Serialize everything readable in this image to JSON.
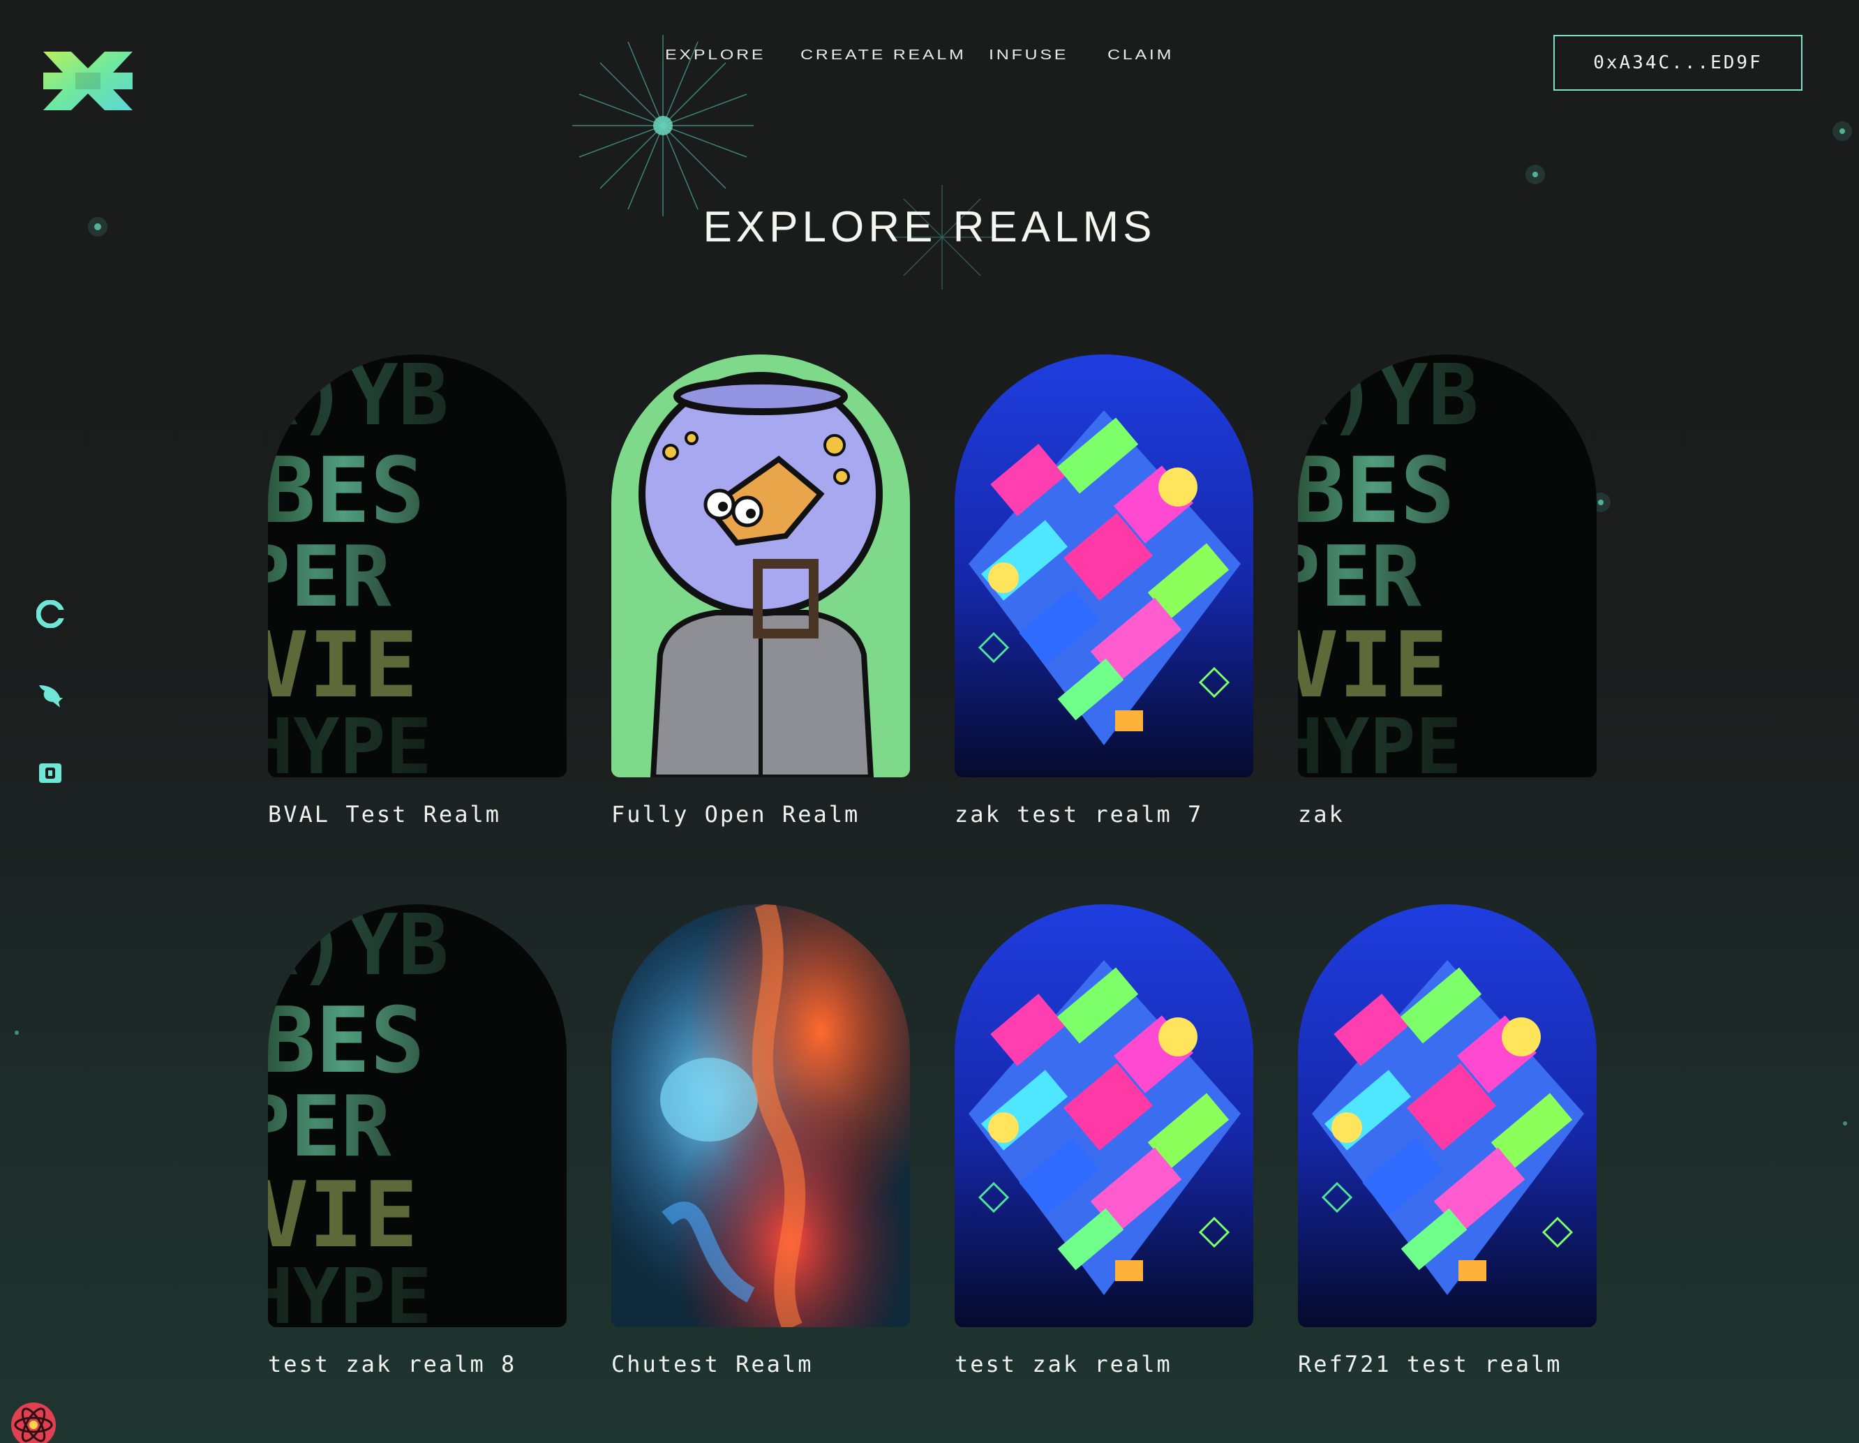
{
  "nav": {
    "items": [
      "EXPLORE",
      "CREATE REALM",
      "INFUSE",
      "CLAIM"
    ]
  },
  "wallet": {
    "address": "0xA34C...ED9F"
  },
  "page": {
    "title": "EXPLORE REALMS"
  },
  "sidebar": {
    "icons": [
      "coin-icon",
      "bird-icon",
      "wallet-icon"
    ]
  },
  "realms": [
    {
      "name": "BVAL Test Realm",
      "art": "text-pattern"
    },
    {
      "name": "Fully Open Realm",
      "art": "fishbowl-knight"
    },
    {
      "name": "zak test realm 7",
      "art": "glitch-diamond"
    },
    {
      "name": "zak",
      "art": "text-pattern"
    },
    {
      "name": "test zak realm 8",
      "art": "text-pattern"
    },
    {
      "name": "Chutest Realm",
      "art": "smoke"
    },
    {
      "name": "test zak realm",
      "art": "glitch-diamond"
    },
    {
      "name": "Ref721 test realm",
      "art": "glitch-diamond"
    }
  ],
  "colors": {
    "accent": "#7fe3c8",
    "logo_green": "#8ff07a",
    "icon_teal": "#6fe6d6",
    "background": "#1b1c1c"
  }
}
